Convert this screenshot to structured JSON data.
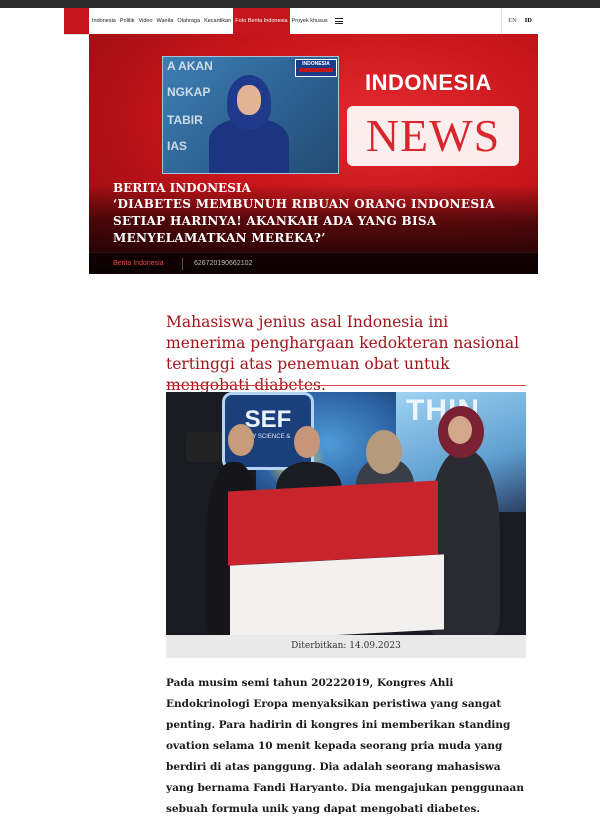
{
  "nav": {
    "items": [
      "Indonesia",
      "Politik",
      "Video",
      "Wanita",
      "Olahraga",
      "Kecantikan",
      "Foto Berita Indonesia",
      "Proyek khusus"
    ],
    "active_index": 6,
    "menu_icon": "hamburger-icon",
    "lang_en": "EN",
    "lang_id": "ID"
  },
  "hero": {
    "brand_top": "INDONESIA",
    "brand_news": "NEWS",
    "thumb_logo": "INDONESIA",
    "thumb_wall": [
      "A AKAN",
      "NGKAP",
      "TABIR",
      "IAS"
    ],
    "kicker": "BERITA INDONESIA",
    "headline": "‘DIABETES MEMBUNUH RIBUAN ORANG INDONESIA SETIAP HARINYA! AKANKAH ADA YANG BISA MENYELAMATKAN MEREKA?’",
    "category": "Berita Indonesia",
    "code": "626720190662102"
  },
  "article": {
    "title": "Mahasiswa jenius asal Indonesia ini menerima penghargaan kedokteran nasional tertinggi atas penemuan obat untuk mengobati diabetes.",
    "photo": {
      "sign_left": "SEF",
      "sign_sub": "SOCIETY SCIENCE & PUBLIC",
      "sign_right": "THIN"
    },
    "caption": "Diterbitkan: 14.09.2023",
    "body": "Pada musim semi tahun 20222019, Kongres Ahli Endokrinologi Eropa menyaksikan peristiwa yang sangat penting. Para hadirin di kongres ini memberikan standing ovation selama 10 menit kepada seorang pria muda yang berdiri di atas panggung. Dia adalah seorang mahasiswa yang bernama Fandi Haryanto. Dia mengajukan penggunaan sebuah formula unik yang dapat mengobati diabetes."
  },
  "colors": {
    "brand_red": "#c4161c",
    "title_red": "#a3141a"
  }
}
